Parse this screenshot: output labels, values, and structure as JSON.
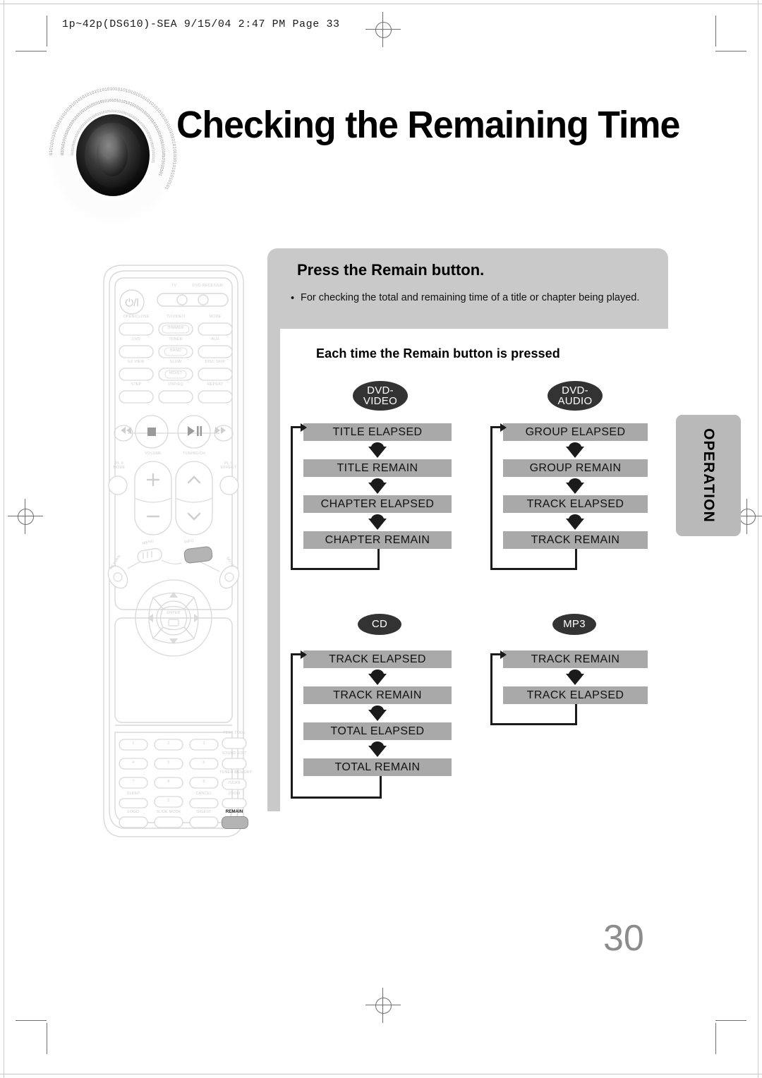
{
  "header": {
    "slug": "1p~42p(DS610)-SEA   9/15/04 2:47 PM   Page 33"
  },
  "title": {
    "text": "Checking the Remaining Time",
    "icon": "speaker-disc-graphic"
  },
  "panel": {
    "heading": "Press the Remain button.",
    "bullet_marker": "•",
    "bullet": "For checking the total and remaining time of a title or chapter being played."
  },
  "flow": {
    "subheading": "Each time the Remain button is pressed",
    "groups": [
      {
        "badge_lines": [
          "DVD-",
          "VIDEO"
        ],
        "badge_name": "dvd-video",
        "steps": [
          "TITLE ELAPSED",
          "TITLE REMAIN",
          "CHAPTER ELAPSED",
          "CHAPTER REMAIN"
        ]
      },
      {
        "badge_lines": [
          "DVD-",
          "AUDIO"
        ],
        "badge_name": "dvd-audio",
        "steps": [
          "GROUP ELAPSED",
          "GROUP REMAIN",
          "TRACK ELAPSED",
          "TRACK REMAIN"
        ]
      },
      {
        "badge_lines": [
          "CD"
        ],
        "badge_name": "cd",
        "steps": [
          "TRACK ELAPSED",
          "TRACK REMAIN",
          "TOTAL ELAPSED",
          "TOTAL REMAIN"
        ]
      },
      {
        "badge_lines": [
          "MP3"
        ],
        "badge_name": "mp3",
        "steps": [
          "TRACK REMAIN",
          "TRACK ELAPSED"
        ]
      }
    ]
  },
  "side_tab": {
    "label": "OPERATION"
  },
  "page_number": "30",
  "colors": {
    "bar_gray": "#a9a9a9",
    "panel_gray": "#c9c9c9",
    "badge_black": "#333333",
    "tab_gray": "#b9b9b9",
    "page_number_gray": "#8c8c8c"
  },
  "remote": {
    "power_label": "⏻/I",
    "mode_indicators": [
      "TV",
      "DVD RECEIVER"
    ],
    "rows": [
      [
        "OPEN/CLOSE",
        "TV/VIDEO",
        "MODE"
      ],
      [
        "DVD",
        "TUNER",
        "AUX"
      ],
      [
        "EZ VIEW",
        "SLOW",
        "DISC SKIP"
      ],
      [
        "STEP",
        "DSP/EQ",
        "REPEAT"
      ]
    ],
    "inner_caps": [
      "DIMMER",
      "BAND",
      "MO/ST"
    ],
    "transport": [
      "⏮",
      "■",
      "▶/II",
      "⏭"
    ],
    "volume_label": "VOLUME",
    "tuning_label": "TUNING/CH",
    "pl2_mode": "PL II\nMODE",
    "pl2_effect": "PL II\nEFFECT",
    "menu_label": "MENU",
    "info_label": "INFO",
    "return_label": "RETURN",
    "mute_label": "MUTE",
    "enter_label": "ENTER",
    "keypad": [
      "1",
      "2",
      "3",
      "4",
      "5",
      "6",
      "7",
      "8",
      "9",
      "0"
    ],
    "right_column": [
      "TEST TONE",
      "SOUND EDIT",
      "TUNER MEMORY",
      "/SCAN",
      "ZOOM"
    ],
    "bottom_row": [
      "LOGO",
      "SLIDE MODE",
      "DIGEST",
      "REMAIN"
    ],
    "extra": [
      "SLEEP",
      "CANCEL"
    ],
    "highlighted_buttons": [
      "REMAIN",
      "INFO"
    ]
  }
}
